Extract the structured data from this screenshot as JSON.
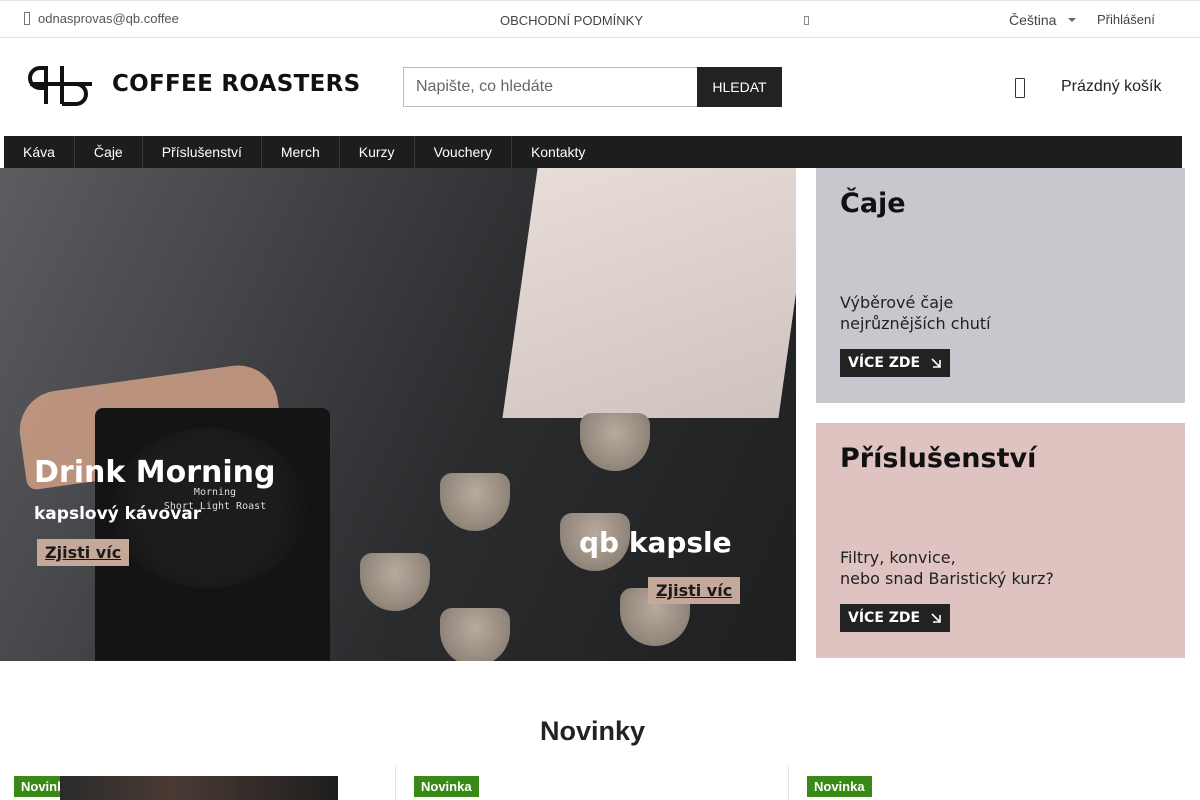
{
  "topbar": {
    "email": "odnasprovas@qb.coffee",
    "terms": "OBCHODNÍ PODMÍNKY",
    "language": "Čeština",
    "login": "Přihlášení"
  },
  "header": {
    "logo_text": "COFFEE ROASTERS",
    "search_placeholder": "Napište, co hledáte",
    "search_button": "HLEDAT",
    "cart_label": "Prázdný košík"
  },
  "nav": {
    "items": [
      "Káva",
      "Čaje",
      "Příslušenství",
      "Merch",
      "Kurzy",
      "Vouchery",
      "Kontakty"
    ]
  },
  "hero": {
    "screen_line1": "Morning",
    "screen_line2": "Short Light Roast",
    "left_title": "Drink Morning",
    "left_subtitle": "kapslový kávovar",
    "left_cta": "Zjisti víc",
    "right_title": "qb kapsle",
    "right_cta": "Zjisti víc"
  },
  "banners": {
    "tea": {
      "title": "Čaje",
      "desc": "Výběrové čaje\nnejrůznějších chutí",
      "cta": "VÍCE ZDE"
    },
    "accessories": {
      "title": "Příslušenství",
      "desc": "Filtry, konvice,\nnebo snad Baristický kurz?",
      "cta": "VÍCE ZDE"
    }
  },
  "novinky": {
    "title": "Novinky",
    "products": [
      {
        "badge": "Novinka"
      },
      {
        "badge": "Novinka"
      },
      {
        "badge": "Novinka"
      }
    ]
  },
  "colors": {
    "nav_bg": "#1d1d1d",
    "badge_green": "#3a8a17",
    "tea_banner": "#c8c7ce",
    "accessories_banner": "#dfc3c1"
  },
  "icons": [
    "mail-icon",
    "info-icon",
    "language-caret-icon",
    "cart-icon",
    "arrow-down-right-icon"
  ]
}
